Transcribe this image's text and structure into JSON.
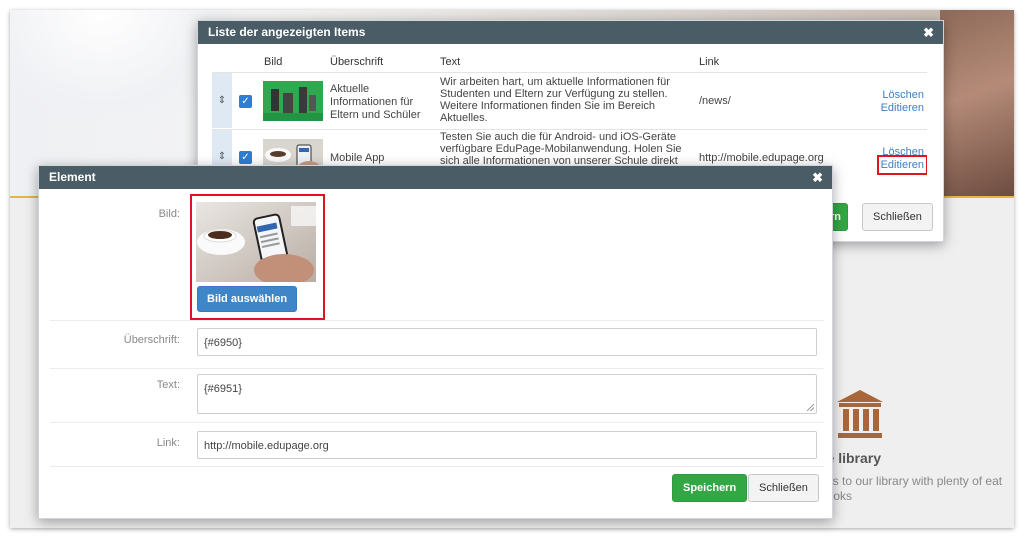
{
  "background": {
    "library_title": "ge library",
    "library_text": "ess to our library with plenty of eat books"
  },
  "list_dialog": {
    "title": "Liste der angezeigten Items",
    "columns": {
      "image": "Bild",
      "heading": "Überschrift",
      "text": "Text",
      "link": "Link"
    },
    "rows": [
      {
        "heading": "Aktuelle Informationen für Eltern und Schüler",
        "text": "Wir arbeiten hart, um aktuelle Informationen für Studenten und Eltern zur Verfügung zu stellen. Weitere Informationen finden Sie im Bereich Aktuelles.",
        "link": "/news/",
        "delete": "Löschen",
        "edit": "Editieren"
      },
      {
        "heading": "Mobile App",
        "text": "Testen Sie auch die für Android- und iOS-Geräte verfügbare EduPage-Mobilanwendung. Holen Sie sich alle Informationen von unserer Schule direkt",
        "link": "http://mobile.edupage.org",
        "delete": "Löschen",
        "edit": "Editieren"
      }
    ],
    "save_label_partial": "rn",
    "close_label": "Schließen"
  },
  "element_dialog": {
    "title": "Element",
    "image_label": "Bild:",
    "select_image": "Bild auswählen",
    "heading_label": "Überschrift:",
    "heading_value": "{#6950}",
    "text_label": "Text:",
    "text_value": "{#6951}",
    "link_label": "Link:",
    "link_value": "http://mobile.edupage.org",
    "save": "Speichern",
    "close": "Schließen"
  },
  "colors": {
    "header": "#4a5c66",
    "primary_green": "#34a745",
    "primary_blue": "#3f86c8",
    "link_blue": "#3d7fc2",
    "highlight_red": "#e0141e",
    "accent_gold": "#e2b843"
  },
  "icons": {
    "close": "close-icon",
    "drag": "drag-handle-icon",
    "checkbox": "checkbox-checked-icon",
    "library": "library-building-icon"
  }
}
